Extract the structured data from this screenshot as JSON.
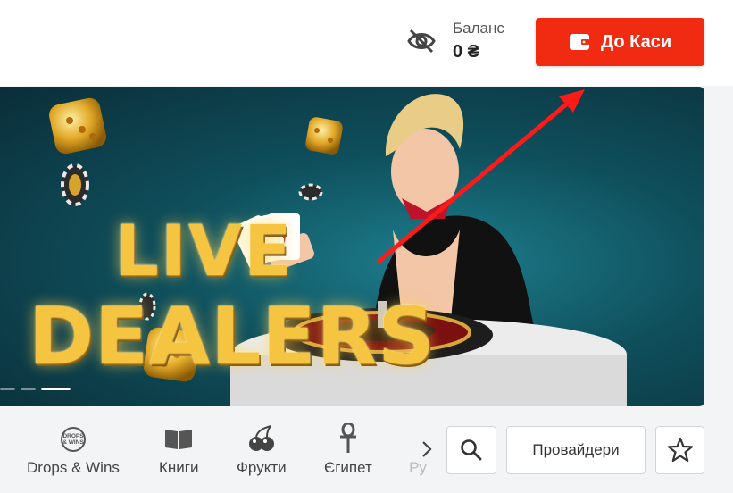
{
  "header": {
    "balance_label": "Баланс",
    "balance_value": "0 ₴",
    "cashier_label": "До Каси"
  },
  "banner": {
    "line1": "LIVE",
    "line2": "DEALERS",
    "slides_total": 3,
    "active_slide": 3
  },
  "categories": [
    {
      "label": "Drops & Wins",
      "icon": "drops-wins-icon"
    },
    {
      "label": "Книги",
      "icon": "book-icon"
    },
    {
      "label": "Фрукти",
      "icon": "cherries-icon"
    },
    {
      "label": "Єгипет",
      "icon": "ankh-icon"
    },
    {
      "label": "Ру",
      "icon": "partial-icon"
    }
  ],
  "actions": {
    "providers_label": "Провайдери"
  },
  "colors": {
    "accent": "#f12b12",
    "gold": "#f5c542",
    "banner_bg": "#0f4f5c"
  }
}
